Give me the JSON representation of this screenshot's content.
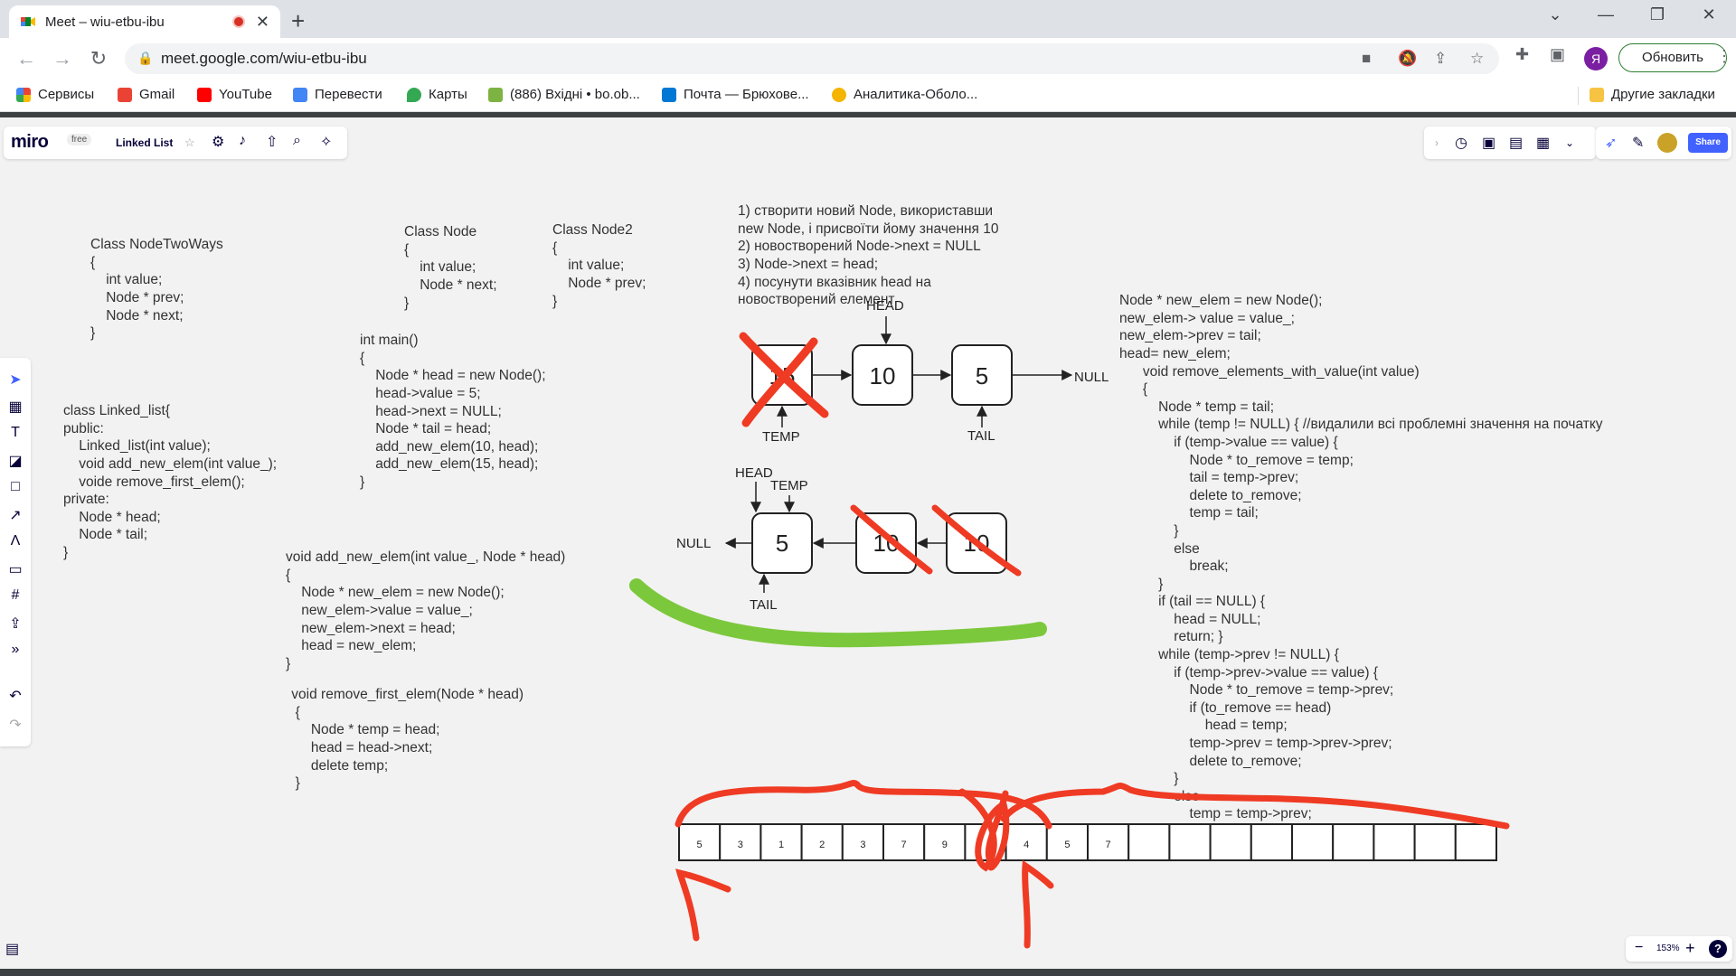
{
  "browser": {
    "tab_title": "Meet – wiu-etbu-ibu",
    "url": "meet.google.com/wiu-etbu-ibu",
    "update_label": "Обновить",
    "avatar_letter": "Я",
    "bookmarks": [
      {
        "label": "Сервисы",
        "icon": "apps-grid-icon"
      },
      {
        "label": "Gmail",
        "icon": "gmail-icon"
      },
      {
        "label": "YouTube",
        "icon": "youtube-icon"
      },
      {
        "label": "Перевести",
        "icon": "translate-icon"
      },
      {
        "label": "Карты",
        "icon": "maps-icon"
      },
      {
        "label": "(886) Вхідні • bo.ob...",
        "icon": "mail-icon"
      },
      {
        "label": "Почта — Брюхове...",
        "icon": "outlook-icon"
      },
      {
        "label": "Аналитика-Оболо...",
        "icon": "analytics-icon"
      }
    ],
    "other_bookmarks": "Другие закладки"
  },
  "miro": {
    "logo": "miro",
    "plan": "free",
    "board_name": "Linked List",
    "share_label": "Share",
    "zoom": "153%",
    "help": "?"
  },
  "board": {
    "node_two_ways": [
      "Class NodeTwoWays",
      "{",
      "    int value;",
      "    Node * prev;",
      "    Node * next;",
      "}"
    ],
    "class_node": [
      "Class Node",
      "{",
      "    int value;",
      "    Node * next;",
      "}"
    ],
    "class_node2": [
      "Class Node2",
      "{",
      "    int value;",
      "    Node * prev;",
      "}"
    ],
    "steps": [
      "1) створити новий Node, використавши",
      "new Node, і присвоїти йому значення 10",
      "2) новостворений Node->next = NULL",
      "3) Node->next = head;",
      "4) посунути вказівник head на",
      "новостворений елемент"
    ],
    "main_fn": [
      "int main()",
      "{",
      "    Node * head = new Node();",
      "    head->value = 5;",
      "    head->next = NULL;",
      "    Node * tail = head;",
      "    add_new_elem(10, head);",
      "    add_new_elem(15, head);",
      "}"
    ],
    "linked_list_class": [
      "class Linked_list{",
      "public:",
      "    Linked_list(int value);",
      "    void add_new_elem(int value_);",
      "    voide remove_first_elem();",
      "private:",
      "    Node * head;",
      "    Node * tail;",
      "}"
    ],
    "add_new_elem": [
      "void add_new_elem(int value_, Node * head)",
      "{",
      "    Node * new_elem = new Node();",
      "    new_elem->value = value_;",
      "    new_elem->next = head;",
      "    head = new_elem;",
      "}"
    ],
    "remove_first": [
      " void remove_first_elem(Node * head)",
      "  {",
      "      Node * temp = head;",
      "      head = head->next;",
      "      delete temp;",
      "  }"
    ],
    "right_code": [
      "Node * new_elem = new Node();",
      "new_elem-> value = value_;",
      "new_elem->prev = tail;",
      "head= new_elem;",
      "      void remove_elements_with_value(int value)",
      "      {",
      "          Node * temp = tail;",
      "          while (temp != NULL) { //видалили всі проблемні значення на початку",
      "              if (temp->value == value) {",
      "                  Node * to_remove = temp;",
      "                  tail = temp->prev;",
      "                  delete to_remove;",
      "                  temp = tail;",
      "              }",
      "              else",
      "                  break;",
      "          }",
      "          if (tail == NULL) {",
      "              head = NULL;",
      "              return; }",
      "          while (temp->prev != NULL) {",
      "              if (temp->prev->value == value) {",
      "                  Node * to_remove = temp->prev;",
      "                  if (to_remove == head)",
      "                      head = temp;",
      "                  temp->prev = temp->prev->prev;",
      "                  delete to_remove;",
      "              }",
      "              else",
      "                  temp = temp->prev;",
      "          }",
      "      }"
    ],
    "diagram_top": {
      "nodes": [
        "15",
        "10",
        "5"
      ],
      "null_label": "NULL",
      "head_label": "HEAD",
      "temp_label": "TEMP",
      "tail_label": "TAIL"
    },
    "diagram_bottom": {
      "nodes": [
        "5",
        "10",
        "10"
      ],
      "null_label": "NULL",
      "head_label": "HEAD",
      "temp_label": "TEMP",
      "tail_label": "TAIL"
    },
    "array_cells": [
      "5",
      "3",
      "1",
      "2",
      "3",
      "7",
      "9",
      "",
      "4",
      "5",
      "7",
      "",
      "",
      "",
      "",
      "",
      "",
      "",
      "",
      ""
    ],
    "colors": {
      "ink": "#333333",
      "red_marker": "#ef3b24",
      "green_marker": "#7cc83c",
      "canvas": "#f2f2f2"
    }
  }
}
